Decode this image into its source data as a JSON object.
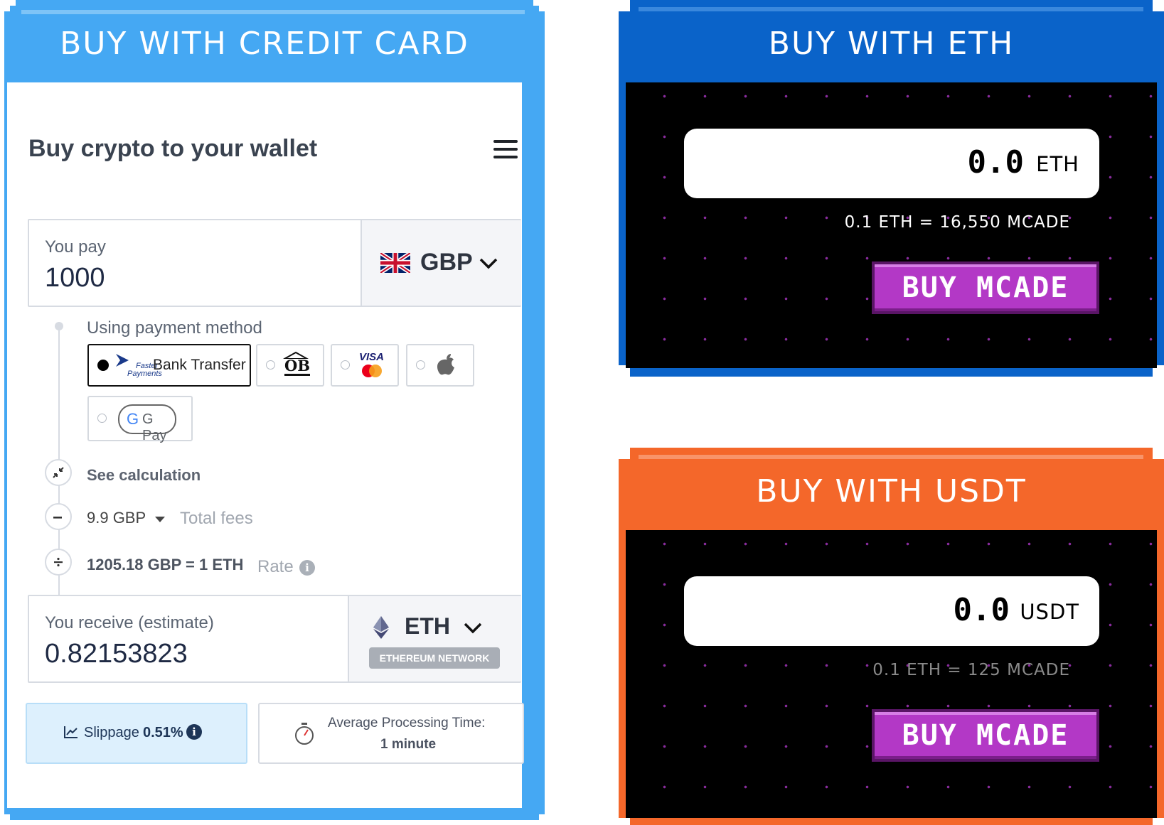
{
  "credit_card_panel": {
    "header": "BUY WITH CREDIT CARD",
    "widget_title": "Buy crypto to your wallet",
    "pay": {
      "label": "You pay",
      "value": "1000",
      "currency": "GBP"
    },
    "payment_method_label": "Using payment method",
    "payment_methods": [
      "Bank Transfer",
      "OB",
      "VISA",
      "Apple Pay",
      "G Pay"
    ],
    "faster_payments_text": [
      "Faster",
      "Payments"
    ],
    "selected_payment_method": "Bank Transfer",
    "see_calculation": "See calculation",
    "fees": {
      "value": "9.9 GBP",
      "label": "Total fees"
    },
    "rate": {
      "value": "1205.18 GBP = 1 ETH",
      "label": "Rate"
    },
    "receive": {
      "label": "You receive (estimate)",
      "value": "0.82153823",
      "currency": "ETH",
      "network": "ETHEREUM NETWORK"
    },
    "slippage": {
      "label": "Slippage",
      "value": "0.51%"
    },
    "processing": {
      "label": "Average Processing Time:",
      "value": "1 minute"
    }
  },
  "eth_panel": {
    "header": "BUY WITH ETH",
    "amount": "0.0",
    "unit": "ETH",
    "rate": "0.1 ETH = 16,550 MCADE",
    "button": "BUY MCADE"
  },
  "usdt_panel": {
    "header": "BUY WITH USDT",
    "amount": "0.0",
    "unit": "USDT",
    "rate": "0.1 ETH = 125 MCADE",
    "button": "BUY MCADE"
  },
  "colors": {
    "credit_blue": "#45a8f3",
    "eth_blue": "#0a63c9",
    "usdt_orange": "#f4672a",
    "button_purple": "#b338c6",
    "dot_purple": "#8a2c9e"
  }
}
